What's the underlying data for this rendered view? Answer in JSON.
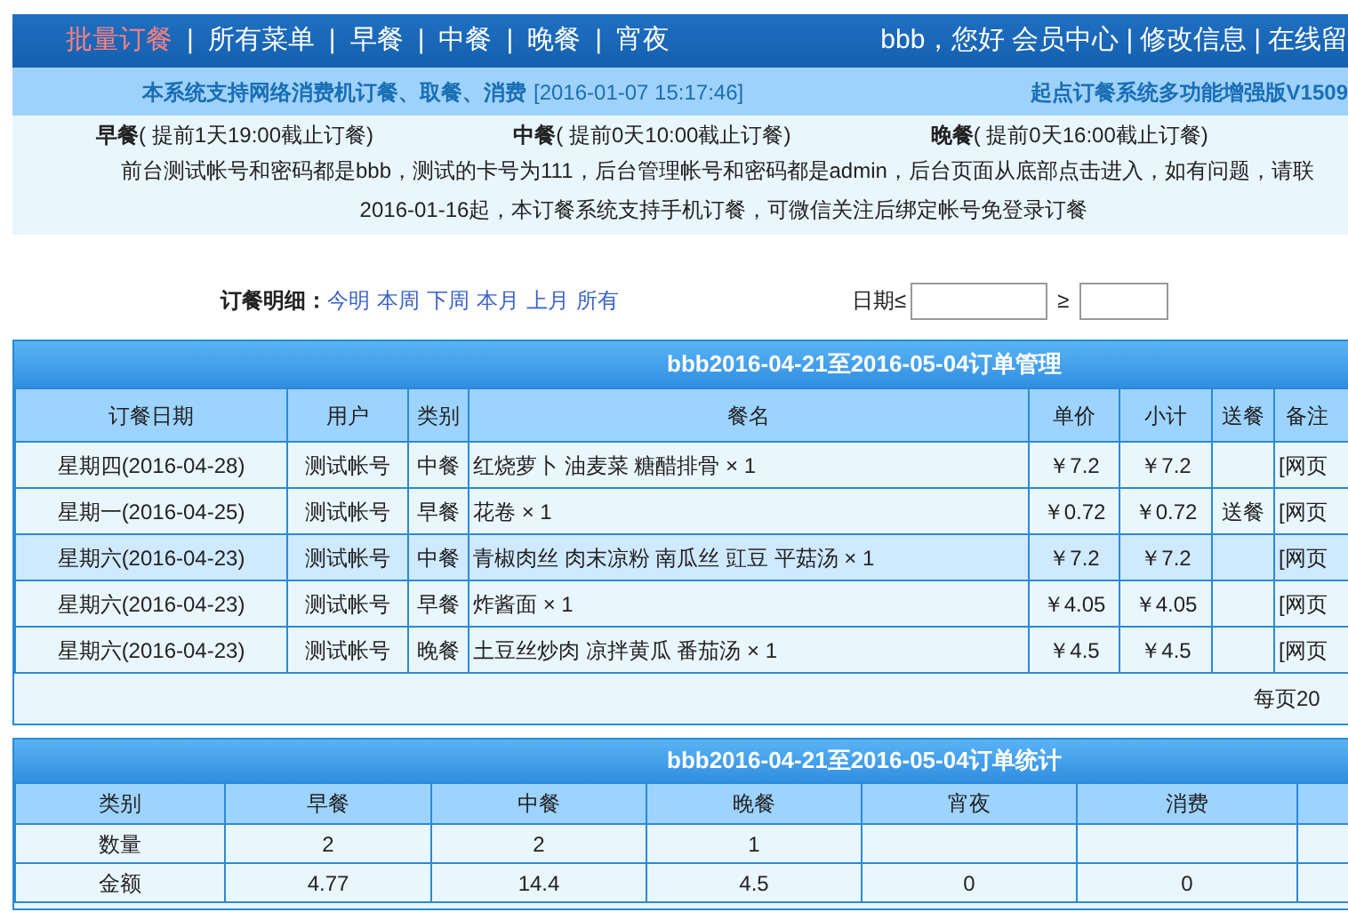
{
  "nav": {
    "separator": "|",
    "items": [
      {
        "label": "批量订餐",
        "selected": true
      },
      {
        "label": "所有菜单",
        "selected": false
      },
      {
        "label": "早餐",
        "selected": false
      },
      {
        "label": "中餐",
        "selected": false
      },
      {
        "label": "晚餐",
        "selected": false
      },
      {
        "label": "宵夜",
        "selected": false
      }
    ],
    "greeting": "bbb，您好",
    "user_links": [
      "会员中心",
      "修改信息",
      "在线留"
    ]
  },
  "notice_bar": {
    "text": "本系统支持网络消费机订餐、取餐、消费",
    "datetime": "[2016-01-07 15:17:46]",
    "version": "起点订餐系统多功能增强版V1509"
  },
  "deadlines": [
    {
      "meal": "早餐",
      "rule": "( 提前1天19:00截止订餐)"
    },
    {
      "meal": "中餐",
      "rule": "( 提前0天10:00截止订餐)"
    },
    {
      "meal": "晚餐",
      "rule": "( 提前0天16:00截止订餐)"
    }
  ],
  "info_lines": [
    "前台测试帐号和密码都是bbb，测试的卡号为111，后台管理帐号和密码都是admin，后台页面从底部点击进入，如有问题，请联",
    "2016-01-16起，本订餐系统支持手机订餐，可微信关注后绑定帐号免登录订餐"
  ],
  "filter": {
    "label": "订餐明细：",
    "links": [
      "今明",
      "本周",
      "下周",
      "本月",
      "上月",
      "所有"
    ],
    "date_label": "日期≤",
    "date_label_2": "≥"
  },
  "orders": {
    "title": "bbb2016-04-21至2016-05-04订单管理",
    "columns": [
      "订餐日期",
      "用户",
      "类别",
      "餐名",
      "单价",
      "小计",
      "送餐",
      "备注"
    ],
    "rows": [
      {
        "selected": false,
        "cells": [
          "星期四(2016-04-28)",
          "测试帐号",
          "中餐",
          "红烧萝卜 油麦菜 糖醋排骨 × 1",
          "￥7.2",
          "￥7.2",
          "",
          "[网页"
        ]
      },
      {
        "selected": false,
        "cells": [
          "星期一(2016-04-25)",
          "测试帐号",
          "早餐",
          "花卷 × 1",
          "￥0.72",
          "￥0.72",
          "送餐",
          "[网页"
        ]
      },
      {
        "selected": true,
        "cells": [
          "星期六(2016-04-23)",
          "测试帐号",
          "中餐",
          "青椒肉丝 肉末凉粉 南瓜丝 豇豆 平菇汤 × 1",
          "￥7.2",
          "￥7.2",
          "",
          "[网页"
        ]
      },
      {
        "selected": false,
        "cells": [
          "星期六(2016-04-23)",
          "测试帐号",
          "早餐",
          "炸酱面 × 1",
          "￥4.05",
          "￥4.05",
          "",
          "[网页"
        ]
      },
      {
        "selected": false,
        "cells": [
          "星期六(2016-04-23)",
          "测试帐号",
          "晚餐",
          "土豆丝炒肉 凉拌黄瓜 番茄汤 × 1",
          "￥4.5",
          "￥4.5",
          "",
          "[网页"
        ]
      }
    ],
    "footer": "每页20"
  },
  "stats": {
    "title": "bbb2016-04-21至2016-05-04订单统计",
    "columns": [
      "类别",
      "早餐",
      "中餐",
      "晚餐",
      "宵夜",
      "消费",
      ""
    ],
    "rows": [
      [
        "数量",
        "2",
        "2",
        "1",
        "",
        "",
        ""
      ],
      [
        "金额",
        "4.77",
        "14.4",
        "4.5",
        "0",
        "0",
        ""
      ]
    ]
  }
}
